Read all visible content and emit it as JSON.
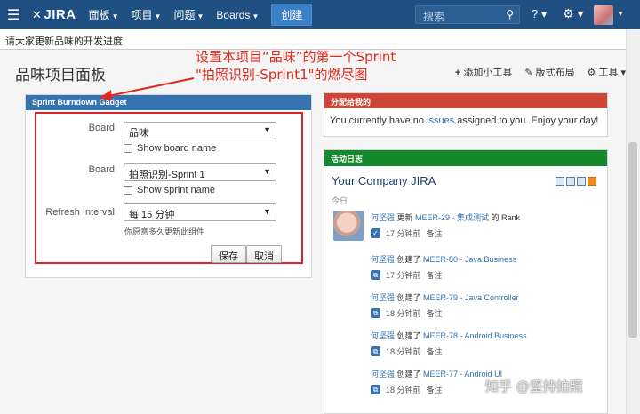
{
  "topnav": {
    "brand": "JIRA",
    "menus": [
      "面板",
      "项目",
      "问题",
      "Boards"
    ],
    "create_label": "创建",
    "search_placeholder": "搜索"
  },
  "announcement": "请大家更新品味的开发进度",
  "dashboard": {
    "title": "品味项目面板",
    "tools": [
      "添加小工具",
      "版式布局",
      "工具"
    ]
  },
  "annotation": {
    "line1": "设置本项目“品味”的第一个Sprint",
    "line2": "\"拍照识别-Sprint1\"的燃尽图"
  },
  "burndown_gadget": {
    "title": "Sprint Burndown Gadget",
    "board_label": "Board",
    "board_value": "品味",
    "show_board_name": "Show board name",
    "sprint_label": "Board",
    "sprint_value": "拍照识别-Sprint 1",
    "show_sprint_name": "Show sprint name",
    "refresh_label": "Refresh Interval",
    "refresh_value": "每 15 分钟",
    "refresh_hint": "你愿意多久更新此组件",
    "save_label": "保存",
    "cancel_label": "取消"
  },
  "assigned_gadget": {
    "title": "分配给我的",
    "text_before": "You currently have no ",
    "link": "issues",
    "text_after": " assigned to you. Enjoy your day!"
  },
  "activity_gadget": {
    "title": "活动日志",
    "stream_title": "Your Company JIRA",
    "today": "今日",
    "entries": [
      {
        "user": "何坚强",
        "action": " 更新 ",
        "issue": "MEER-29 - 集成测试",
        "suffix": " 的 Rank",
        "time": "17 分钟前",
        "note": "备注"
      },
      {
        "user": "何坚强",
        "action": " 创建了 ",
        "issue": "MEER-80 - Java Business",
        "suffix": "",
        "time": "17 分钟前",
        "note": "备注"
      },
      {
        "user": "何坚强",
        "action": " 创建了 ",
        "issue": "MEER-79 - Java Controller",
        "suffix": "",
        "time": "18 分钟前",
        "note": "备注"
      },
      {
        "user": "何坚强",
        "action": " 创建了 ",
        "issue": "MEER-78 - Android Business",
        "suffix": "",
        "time": "18 分钟前",
        "note": "备注"
      },
      {
        "user": "何坚强",
        "action": " 创建了 ",
        "issue": "MEER-77 - Android UI",
        "suffix": "",
        "time": "18 分钟前",
        "note": "备注"
      }
    ]
  },
  "watermark": "知乎 @坚持拍照",
  "colors": {
    "nav": "#205081",
    "burndown_header": "#3572b0",
    "assigned_header": "#d04437",
    "activity_header": "#14892c",
    "annotation": "#e5281b"
  }
}
